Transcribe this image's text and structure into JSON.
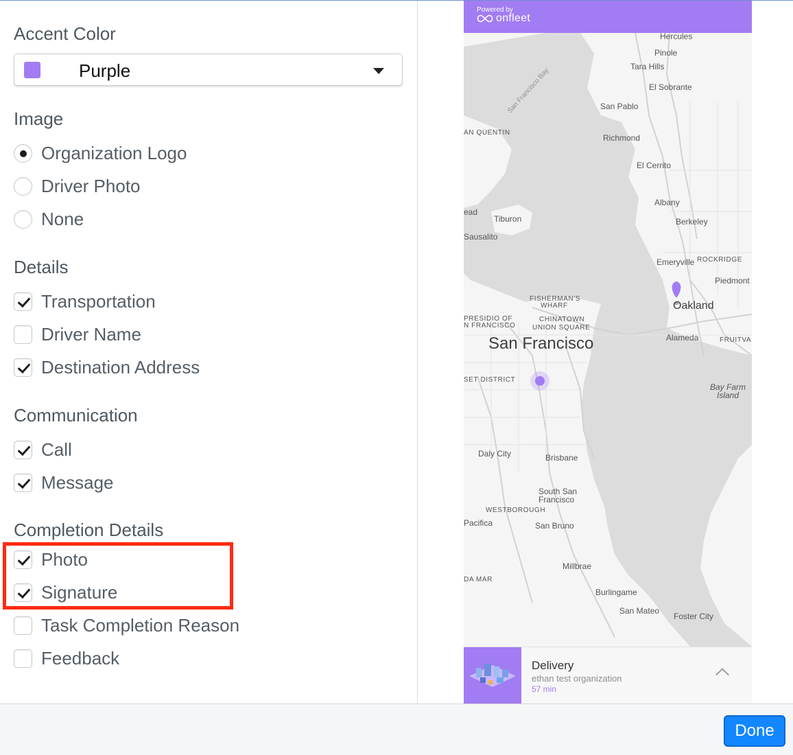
{
  "accent": {
    "title": "Accent Color",
    "selected": "Purple",
    "color": "#a27cf2"
  },
  "image": {
    "title": "Image",
    "options": [
      {
        "label": "Organization Logo",
        "selected": true
      },
      {
        "label": "Driver Photo",
        "selected": false
      },
      {
        "label": "None",
        "selected": false
      }
    ]
  },
  "details": {
    "title": "Details",
    "options": [
      {
        "label": "Transportation",
        "checked": true
      },
      {
        "label": "Driver Name",
        "checked": false
      },
      {
        "label": "Destination Address",
        "checked": true
      }
    ]
  },
  "communication": {
    "title": "Communication",
    "options": [
      {
        "label": "Call",
        "checked": true
      },
      {
        "label": "Message",
        "checked": true
      }
    ]
  },
  "completion": {
    "title": "Completion Details",
    "options": [
      {
        "label": "Photo",
        "checked": true
      },
      {
        "label": "Signature",
        "checked": true
      },
      {
        "label": "Task Completion Reason",
        "checked": false
      },
      {
        "label": "Feedback",
        "checked": false
      }
    ]
  },
  "preview": {
    "powered_by": "Powered by",
    "brand": "onfleet",
    "card_title": "Delivery",
    "card_subtitle": "ethan test organization",
    "card_eta": "57 min",
    "map_labels": {
      "hercules": "Hercules",
      "pinole": "Pinole",
      "tara_hills": "Tara Hills",
      "el_sobrante": "El Sobrante",
      "san_pablo": "San Pablo",
      "san_quentin": "AN QUENTIN",
      "richmond": "Richmond",
      "el_cerrito": "El Cerrito",
      "albany": "Albany",
      "berkeley": "Berkeley",
      "tiburon": "Tiburon",
      "sausalito": "Sausalito",
      "head": "ead",
      "emeryville": "Emeryville",
      "rockridge": "ROCKRIDGE",
      "piedmont": "Piedmont",
      "fishermans_wharf_1": "FISHERMAN'S",
      "fishermans_wharf_2": "WHARF",
      "oakland": "Oakland",
      "presidio_1": "PRESIDIO OF",
      "presidio_2": "N FRANCISCO",
      "chinatown": "CHINATOWN",
      "union_square": "UNION SQUARE",
      "san_francisco": "San Francisco",
      "alameda": "Alameda",
      "fruitvale": "FRUITVAL",
      "sunset": "SET DISTRICT",
      "bay_farm_1": "Bay Farm",
      "bay_farm_2": "Island",
      "daly_city": "Daly City",
      "brisbane": "Brisbane",
      "south_sf_1": "South San",
      "south_sf_2": "Francisco",
      "westborough": "WESTBOROUGH",
      "pacifica": "Pacifica",
      "san_bruno": "San Bruno",
      "millbrae": "Millbrae",
      "da_mar": "DA MAR",
      "burlingame": "Burlingame",
      "san_mateo": "San Mateo",
      "foster_city": "Foster City",
      "sf_bay": "San Francisco Bay"
    }
  },
  "footer": {
    "done_label": "Done"
  }
}
